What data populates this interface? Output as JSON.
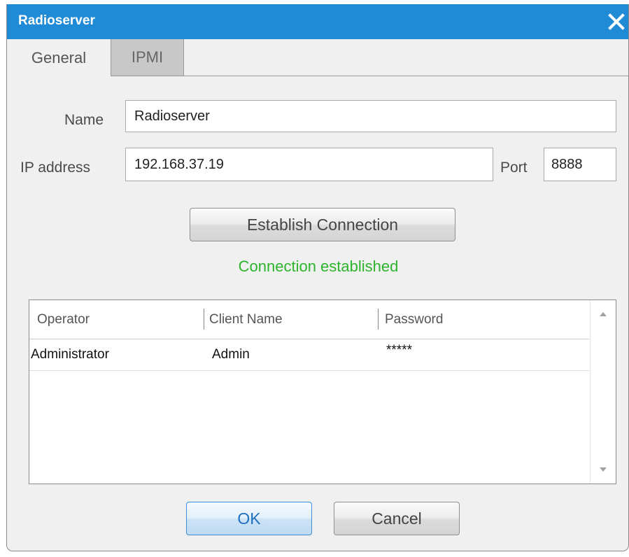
{
  "window": {
    "title": "Radioserver"
  },
  "tabs": [
    {
      "label": "General",
      "active": true
    },
    {
      "label": "IPMI",
      "active": false
    }
  ],
  "form": {
    "name_label": "Name",
    "name_value": "Radioserver",
    "ip_label": "IP address",
    "ip_value": "192.168.37.19",
    "port_label": "Port",
    "port_value": "8888"
  },
  "connection": {
    "button_label": "Establish Connection",
    "status_text": "Connection established",
    "status_color": "#2db42d"
  },
  "table": {
    "columns": [
      "Operator",
      "Client Name",
      "Password"
    ],
    "rows": [
      [
        "Administrator",
        "Admin",
        "*****"
      ]
    ]
  },
  "footer": {
    "ok_label": "OK",
    "cancel_label": "Cancel"
  },
  "colors": {
    "titlebar": "#1f8ad6",
    "accent": "#3c8fd6"
  },
  "icons": {
    "close": "close-icon",
    "scroll_up": "scroll-up-arrow-icon",
    "scroll_down": "scroll-down-arrow-icon"
  }
}
